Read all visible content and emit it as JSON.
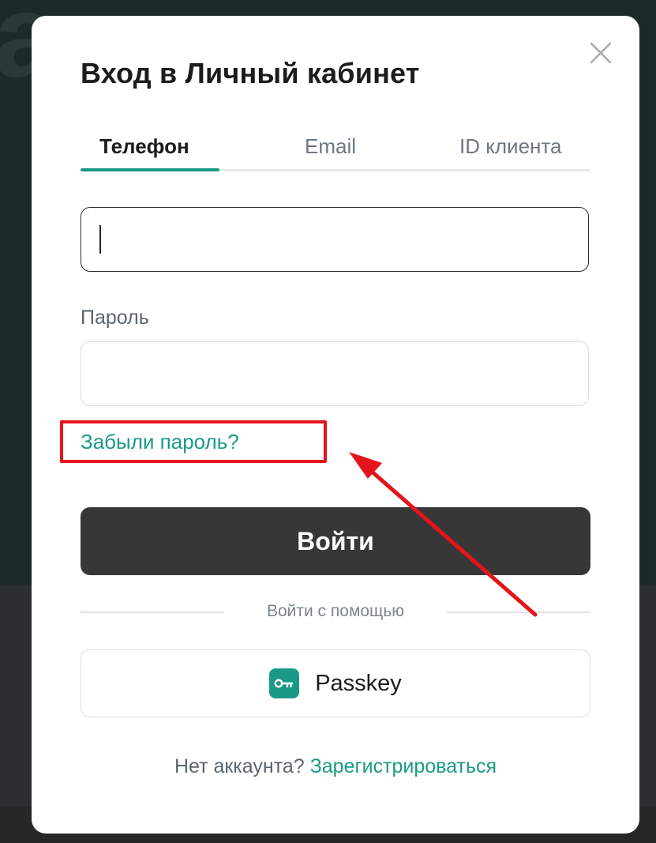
{
  "modal": {
    "title": "Вход в Личный кабинет",
    "tabs": [
      {
        "label": "Телефон",
        "active": true
      },
      {
        "label": "Email",
        "active": false
      },
      {
        "label": "ID клиента",
        "active": false
      }
    ],
    "phone_input": {
      "value": "",
      "placeholder": ""
    },
    "password": {
      "label": "Пароль",
      "value": ""
    },
    "forgot_link": "Забыли пароль?",
    "login_button": "Войти",
    "divider_text": "Войти с помощью",
    "passkey_button": {
      "label": "Passkey",
      "icon": "key-icon"
    },
    "footer": {
      "text": "Нет аккаунта?",
      "link": "Зарегистрироваться"
    }
  },
  "annotation": {
    "highlight_color": "#e5141b",
    "target": "Забыли пароль?"
  },
  "colors": {
    "accent": "#1a9a86",
    "primary_button": "#373737",
    "text": "#1c1c1c",
    "muted_text": "#5a6570"
  }
}
